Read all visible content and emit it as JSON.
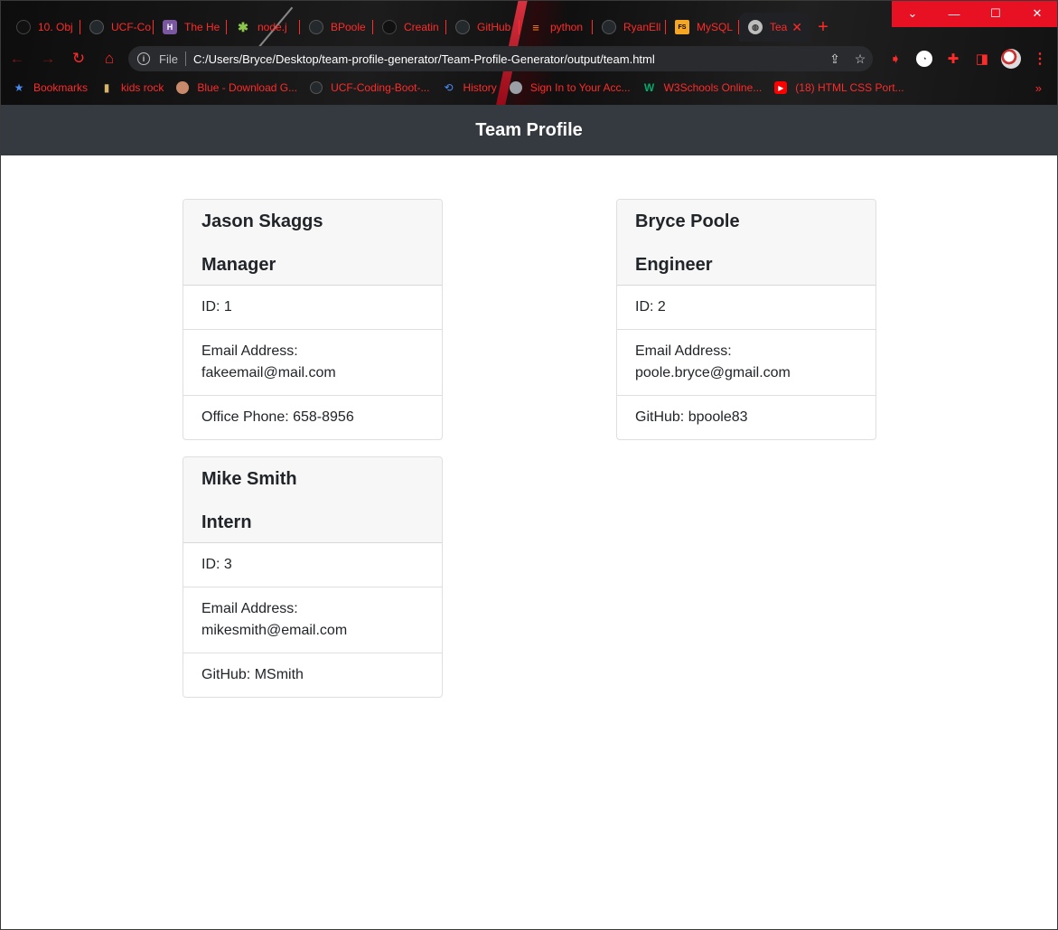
{
  "browser": {
    "tabs": [
      {
        "title": "10. Obj",
        "icon": "dark"
      },
      {
        "title": "UCF-Co",
        "icon": "github"
      },
      {
        "title": "The He",
        "icon": "heroku"
      },
      {
        "title": "node.j",
        "icon": "node"
      },
      {
        "title": "BPoole",
        "icon": "github"
      },
      {
        "title": "Creatin",
        "icon": "github"
      },
      {
        "title": "GitHub",
        "icon": "github"
      },
      {
        "title": "python",
        "icon": "stackoverflow"
      },
      {
        "title": "RyanEll",
        "icon": "github"
      },
      {
        "title": "MySQL",
        "icon": "fs"
      },
      {
        "title": "Tea",
        "icon": "globe",
        "active": true
      }
    ],
    "address": {
      "scheme": "File",
      "url": "C:/Users/Bryce/Desktop/team-profile-generator/Team-Profile-Generator/output/team.html"
    },
    "bookmarks": [
      {
        "label": "Bookmarks",
        "icon": "star-icon"
      },
      {
        "label": "kids rock",
        "icon": "folder-icon"
      },
      {
        "label": "Blue - Download G...",
        "icon": "image-icon"
      },
      {
        "label": "UCF-Coding-Boot-...",
        "icon": "github-icon"
      },
      {
        "label": "History",
        "icon": "history-icon"
      },
      {
        "label": "Sign In to Your Acc...",
        "icon": "globe-icon"
      },
      {
        "label": "W3Schools Online...",
        "icon": "w3schools-icon"
      },
      {
        "label": "(18) HTML CSS Port...",
        "icon": "youtube-icon"
      }
    ],
    "bookmarks_more": "»",
    "accent_color": "#ff2a2a",
    "window_control_color": "#e81123"
  },
  "page": {
    "header_title": "Team Profile",
    "header_color": "#343a40"
  },
  "team": [
    {
      "name": "Jason Skaggs",
      "role": "Manager",
      "id_line": "ID: 1",
      "email_label": "Email Address:",
      "email": "fakeemail@mail.com",
      "extra_line": "Office Phone: 658-8956"
    },
    {
      "name": "Bryce Poole",
      "role": "Engineer",
      "id_line": "ID: 2",
      "email_label": "Email Address:",
      "email": "poole.bryce@gmail.com",
      "extra_line": "GitHub: bpoole83"
    },
    {
      "name": "Mike Smith",
      "role": "Intern",
      "id_line": "ID: 3",
      "email_label": "Email Address:",
      "email": "mikesmith@email.com",
      "extra_line": "GitHub: MSmith"
    }
  ]
}
